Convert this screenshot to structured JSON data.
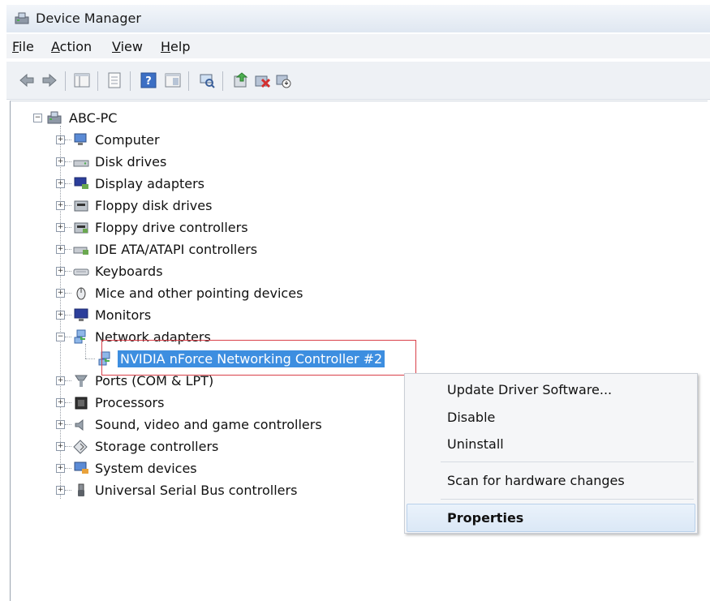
{
  "window": {
    "title": "Device Manager"
  },
  "menu": [
    {
      "label": "File",
      "accel": "F"
    },
    {
      "label": "Action",
      "accel": "A"
    },
    {
      "label": "View",
      "accel": "V"
    },
    {
      "label": "Help",
      "accel": "H"
    }
  ],
  "toolbar": [
    "back-icon",
    "forward-icon",
    "show-hide-tree-icon",
    "properties-icon",
    "help-icon",
    "view-icon",
    "scan-hardware-icon",
    "update-driver-icon",
    "uninstall-icon",
    "disable-icon"
  ],
  "tree": {
    "root": "ABC-PC",
    "categories": [
      {
        "label": "Computer",
        "icon": "computer-icon"
      },
      {
        "label": "Disk drives",
        "icon": "disk-drive-icon"
      },
      {
        "label": "Display adapters",
        "icon": "display-adapter-icon"
      },
      {
        "label": "Floppy disk drives",
        "icon": "floppy-disk-icon"
      },
      {
        "label": "Floppy drive controllers",
        "icon": "floppy-controller-icon"
      },
      {
        "label": "IDE ATA/ATAPI controllers",
        "icon": "ide-controller-icon"
      },
      {
        "label": "Keyboards",
        "icon": "keyboard-icon"
      },
      {
        "label": "Mice and other pointing devices",
        "icon": "mouse-icon"
      },
      {
        "label": "Monitors",
        "icon": "monitor-icon"
      },
      {
        "label": "Network adapters",
        "icon": "network-adapter-icon",
        "expanded": true
      },
      {
        "label": "Ports (COM & LPT)",
        "icon": "port-icon"
      },
      {
        "label": "Processors",
        "icon": "processor-icon"
      },
      {
        "label": "Sound, video and game controllers",
        "icon": "sound-icon"
      },
      {
        "label": "Storage controllers",
        "icon": "storage-icon"
      },
      {
        "label": "System devices",
        "icon": "system-devices-icon"
      },
      {
        "label": "Universal Serial Bus controllers",
        "icon": "usb-icon"
      }
    ],
    "selected_device": "NVIDIA nForce Networking Controller #2"
  },
  "context_menu": {
    "items": [
      "Update Driver Software...",
      "Disable",
      "Uninstall",
      "Scan for hardware changes",
      "Properties"
    ],
    "highlighted": "Properties"
  },
  "colors": {
    "selection": "#3d8ee0",
    "highlight_box": "#d9414a",
    "menu_hover": "#dbe8f6"
  }
}
